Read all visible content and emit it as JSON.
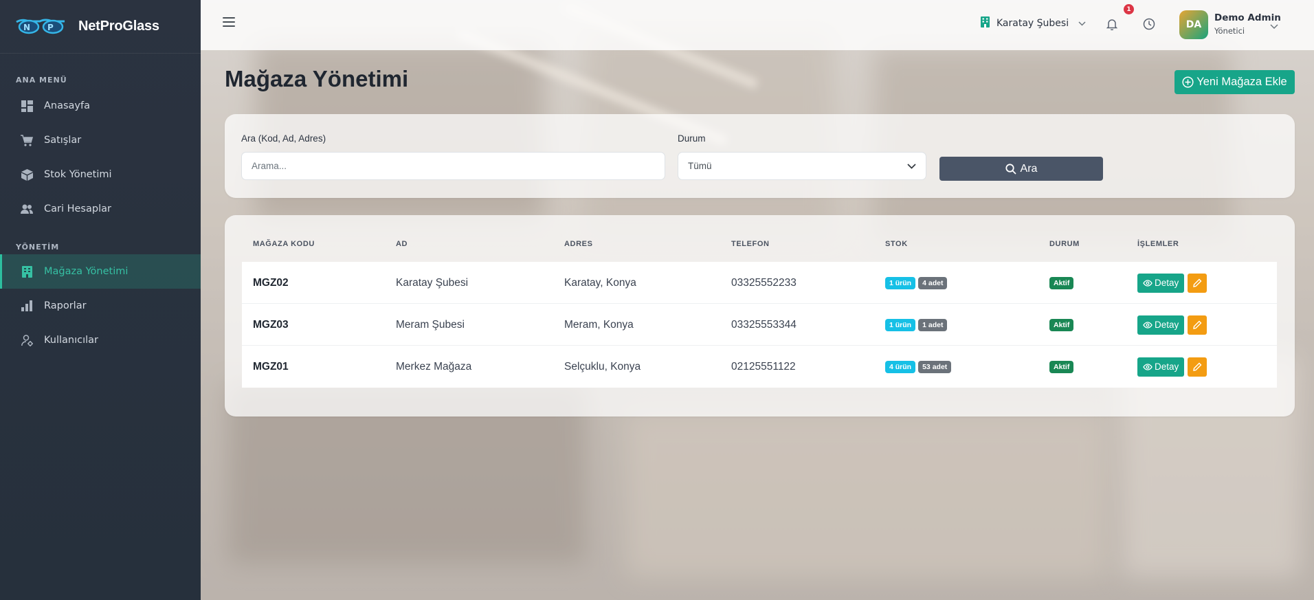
{
  "brand": {
    "name": "NetProGlass",
    "logo_icon": "glasses-logo-icon"
  },
  "sidebar": {
    "section_main": "ANA MENÜ",
    "section_admin": "YÖNETİM",
    "items": [
      {
        "label": "Anasayfa",
        "icon": "dashboard-icon"
      },
      {
        "label": "Satışlar",
        "icon": "cart-icon"
      },
      {
        "label": "Stok Yönetimi",
        "icon": "box-icon"
      },
      {
        "label": "Cari Hesaplar",
        "icon": "users-icon"
      },
      {
        "label": "Mağaza Yönetimi",
        "icon": "building-icon",
        "active": true
      },
      {
        "label": "Raporlar",
        "icon": "bar-chart-icon"
      },
      {
        "label": "Kullanıcılar",
        "icon": "user-gear-icon"
      }
    ]
  },
  "topbar": {
    "branch": "Karatay Şubesi",
    "notifications_count": "1",
    "user": {
      "initials": "DA",
      "name": "Demo Admin",
      "role": "Yönetici"
    }
  },
  "page": {
    "title": "Mağaza Yönetimi",
    "add_button": "Yeni Mağaza Ekle"
  },
  "filter": {
    "search_label": "Ara (Kod, Ad, Adres)",
    "search_placeholder": "Arama...",
    "status_label": "Durum",
    "status_value": "Tümü",
    "search_button": "Ara"
  },
  "table": {
    "headers": [
      "MAĞAZA KODU",
      "AD",
      "ADRES",
      "TELEFON",
      "STOK",
      "DURUM",
      "İŞLEMLER"
    ],
    "rows": [
      {
        "code": "MGZ02",
        "name": "Karatay Şubesi",
        "address": "Karatay, Konya",
        "phone": "03325552233",
        "stock_products": "1 ürün",
        "stock_qty": "4 adet",
        "status": "Aktif"
      },
      {
        "code": "MGZ03",
        "name": "Meram Şubesi",
        "address": "Meram, Konya",
        "phone": "03325553344",
        "stock_products": "1 ürün",
        "stock_qty": "1 adet",
        "status": "Aktif"
      },
      {
        "code": "MGZ01",
        "name": "Merkez Mağaza",
        "address": "Selçuklu, Konya",
        "phone": "02125551122",
        "stock_products": "4 ürün",
        "stock_qty": "53 adet",
        "status": "Aktif"
      }
    ],
    "detail_button": "Detay"
  },
  "colors": {
    "accent": "#17a589",
    "sidebar": "#2b3340",
    "edit": "#f39c12",
    "status_active": "#198754",
    "stock_badge": "#16c0e6"
  }
}
